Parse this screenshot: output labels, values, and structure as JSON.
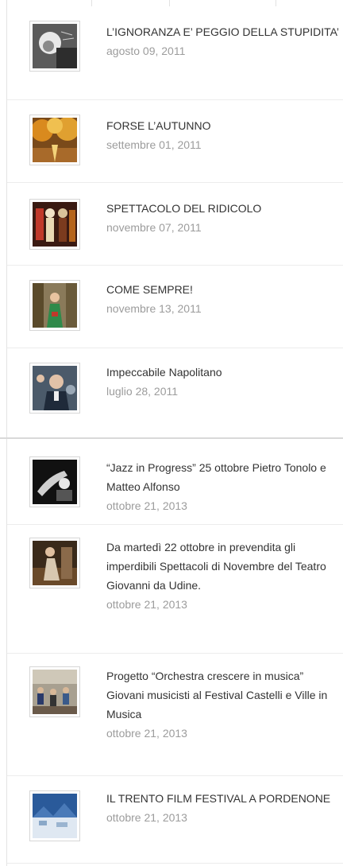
{
  "sections": [
    {
      "items": [
        {
          "title": "L’IGNORANZA E’ PEGGIO DELLA STUPIDITA’",
          "date": "agosto 09, 2011",
          "thumb": "einstein-photo"
        },
        {
          "title": "FORSE L’AUTUNNO",
          "date": "settembre 01, 2011",
          "thumb": "autumn-trees-photo"
        },
        {
          "title": "SPETTACOLO DEL RIDICOLO",
          "date": "novembre 07, 2011",
          "thumb": "masks-photo"
        },
        {
          "title": "COME SEMPRE!",
          "date": "novembre 13, 2011",
          "thumb": "green-figure-photo"
        },
        {
          "title": "Impeccabile Napolitano",
          "date": "luglio 28, 2011",
          "thumb": "napolitano-photo"
        }
      ]
    },
    {
      "items": [
        {
          "title": "“Jazz in Progress” 25 ottobre Pietro Tonolo e Matteo Alfonso",
          "date": "ottobre 21, 2013",
          "thumb": "jazz-musician-photo"
        },
        {
          "title": "Da martedì 22 ottobre in prevendita gli imperdibili Spettacoli di Novembre del Teatro Giovanni da Udine.",
          "date": "ottobre 21, 2013",
          "thumb": "theatre-stage-photo"
        },
        {
          "title": "Progetto “Orchestra crescere in musica” Giovani musicisti al Festival Castelli e Ville in Musica",
          "date": "ottobre 21, 2013",
          "thumb": "orchestra-photo"
        },
        {
          "title": "IL TRENTO FILM FESTIVAL A PORDENONE",
          "date": "ottobre 21, 2013",
          "thumb": "snow-mountain-photo"
        }
      ]
    }
  ],
  "colors": {
    "title": "#333333",
    "date": "#9c9c9c",
    "divider": "#ececec"
  }
}
